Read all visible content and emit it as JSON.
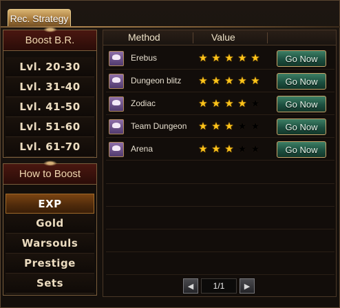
{
  "title_tab": "Rec. Strategy",
  "boost_br": {
    "header": "Boost B.R.",
    "items": [
      "Lvl. 20-30",
      "Lvl. 31-40",
      "Lvl. 41-50",
      "Lvl. 51-60",
      "Lvl. 61-70"
    ]
  },
  "how_to_boost": {
    "header": "How to Boost",
    "items": [
      "EXP",
      "Gold",
      "Warsouls",
      "Prestige",
      "Sets"
    ],
    "selected": "EXP"
  },
  "table": {
    "columns": [
      "Method",
      "Value"
    ],
    "rows": [
      {
        "name": "Erebus",
        "stars": 5,
        "action": "Go Now",
        "icon": "enhance-icon"
      },
      {
        "name": "Dungeon blitz",
        "stars": 5,
        "action": "Go Now",
        "icon": "enhance-icon"
      },
      {
        "name": "Zodiac",
        "stars": 4,
        "action": "Go Now",
        "icon": "enhance-icon"
      },
      {
        "name": "Team Dungeon",
        "stars": 3,
        "action": "Go Now",
        "icon": "enhance-icon"
      },
      {
        "name": "Arena",
        "stars": 3,
        "action": "Go Now",
        "icon": "enhance-icon"
      }
    ],
    "max_stars": 5
  },
  "pager": {
    "text": "1/1"
  },
  "colors": {
    "star_on": "#ffc41a",
    "button_green": "#1d5040",
    "accent_gold": "#c9a56a"
  }
}
